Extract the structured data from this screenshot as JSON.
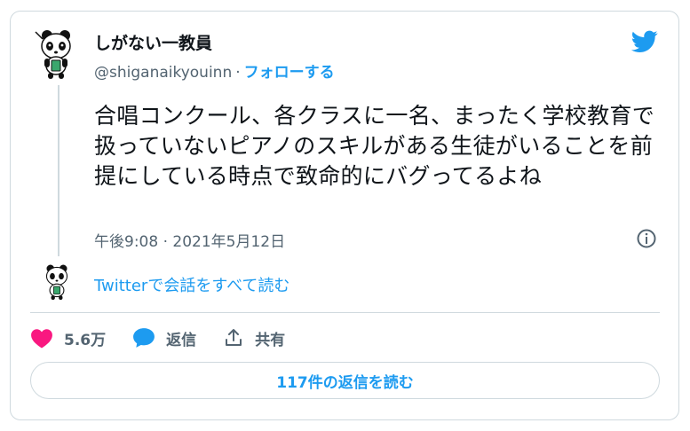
{
  "author": {
    "display_name": "しがない一教員",
    "handle": "@shiganaikyouinn",
    "separator": "·",
    "follow_label": "フォローする"
  },
  "tweet": {
    "text": "合唱コンクール、各クラスに一名、まったく学校教育で扱っていないピアノのスキルがある生徒がいることを前提にしている時点で致命的にバグってるよね",
    "timestamp": "午後9:08 · 2021年5月12日"
  },
  "conversation_link": "Twitterで会話をすべて読む",
  "actions": {
    "like_count": "5.6万",
    "reply_label": "返信",
    "share_label": "共有"
  },
  "read_replies_label": "117件の返信を読む",
  "colors": {
    "accent": "#1d9bf0",
    "like": "#f91880",
    "text": "#0f1419",
    "muted": "#536471",
    "border": "#cfd9de"
  },
  "icons": [
    "panda-avatar",
    "twitter-bird-icon",
    "info-icon",
    "heart-icon",
    "reply-bubble-icon",
    "share-icon"
  ]
}
